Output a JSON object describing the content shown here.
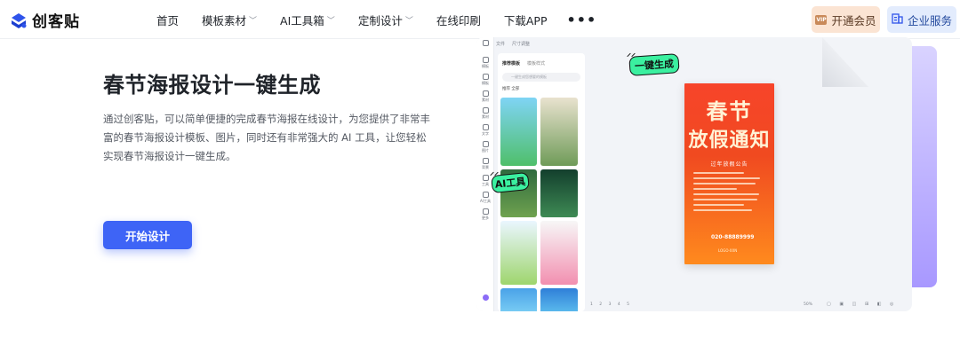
{
  "brand": {
    "name": "创客贴",
    "logo_icon": "chuangketie-logo-icon",
    "accent": "#3e64f6"
  },
  "nav": {
    "items": [
      {
        "label": "首页",
        "dropdown": false
      },
      {
        "label": "模板素材",
        "dropdown": true
      },
      {
        "label": "AI工具箱",
        "dropdown": true
      },
      {
        "label": "定制设计",
        "dropdown": true
      },
      {
        "label": "在线印刷",
        "dropdown": false
      },
      {
        "label": "下载APP",
        "dropdown": false
      }
    ],
    "more_icon": "more-dots-icon",
    "member_label": "开通会员",
    "member_badge": "VIP",
    "enterprise_label": "企业服务"
  },
  "hero": {
    "title": "春节海报设计一键生成",
    "description": "通过创客贴，可以简单便捷的完成春节海报在线设计，为您提供了非常丰富的春节海报设计模板、图片，同时还有非常强大的 AI 工具，让您轻松实现春节海报设计一键生成。",
    "cta_label": "开始设计"
  },
  "mockup": {
    "top_menu": [
      "文件",
      "尺寸调整"
    ],
    "sidebar_items": [
      "模板",
      "模板",
      "素材",
      "素材",
      "文字",
      "图片",
      "背景",
      "工具",
      "AI工具",
      "更多"
    ],
    "panel_tabs": [
      "推荐模板",
      "模板样式"
    ],
    "panel_search_placeholder": "一键生成您想要的模板",
    "panel_filter": "推荐  全部",
    "sticker_generate": "一键生成",
    "sticker_ai": "AI工具",
    "poster": {
      "title_line1": "春节",
      "title_line2": "放假通知",
      "subtitle": "过年放假公告",
      "phone": "020-88889999",
      "logo": "LOGO·XXN"
    },
    "pager": "1 2 3 4 5",
    "zoom": "50%"
  }
}
